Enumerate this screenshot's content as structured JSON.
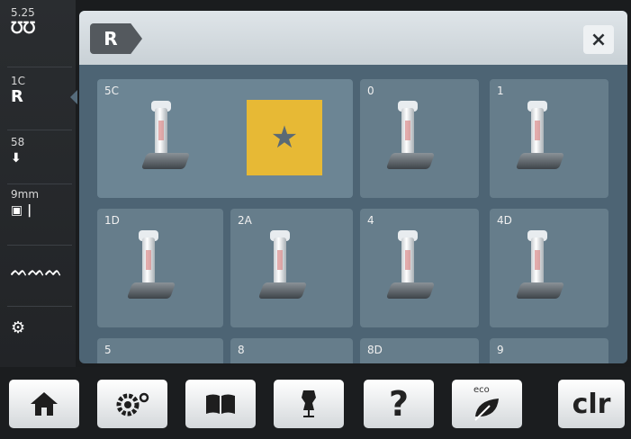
{
  "status_bar": {
    "stitch_width": "5.25",
    "stitch_width_icon": "stitch-width-icon",
    "foot": "1C",
    "foot_icon": "presser-foot-icon",
    "needle": "58",
    "needle_icon": "needle-position-icon",
    "thread": "9mm",
    "thread_icon": "stitch-plate-icon",
    "tension_icon": "zigzag-icon",
    "bobbin_icon": "bobbin-icon"
  },
  "header": {
    "tab_icon": "presser-foot-tab-icon",
    "tab_glyph": "R",
    "close_label": "×"
  },
  "feet": [
    {
      "code": "5C",
      "favorite": true
    },
    {
      "code": "0"
    },
    {
      "code": "1"
    },
    {
      "code": "1D"
    },
    {
      "code": "2A"
    },
    {
      "code": "4"
    },
    {
      "code": "4D"
    },
    {
      "code": "5"
    },
    {
      "code": "8"
    },
    {
      "code": "8D"
    },
    {
      "code": "9"
    }
  ],
  "favorite_icon": "star-icon",
  "toolbar": {
    "home_icon": "home-icon",
    "setup_icon": "settings-icon",
    "tutorial_icon": "book-icon",
    "guide_icon": "dress-form-icon",
    "help_label": "?",
    "eco_label": "eco",
    "clear_label": "clr"
  },
  "colors": {
    "panel": "#4d6474",
    "tile": "#667d8b",
    "favorite": "#e7b935"
  }
}
